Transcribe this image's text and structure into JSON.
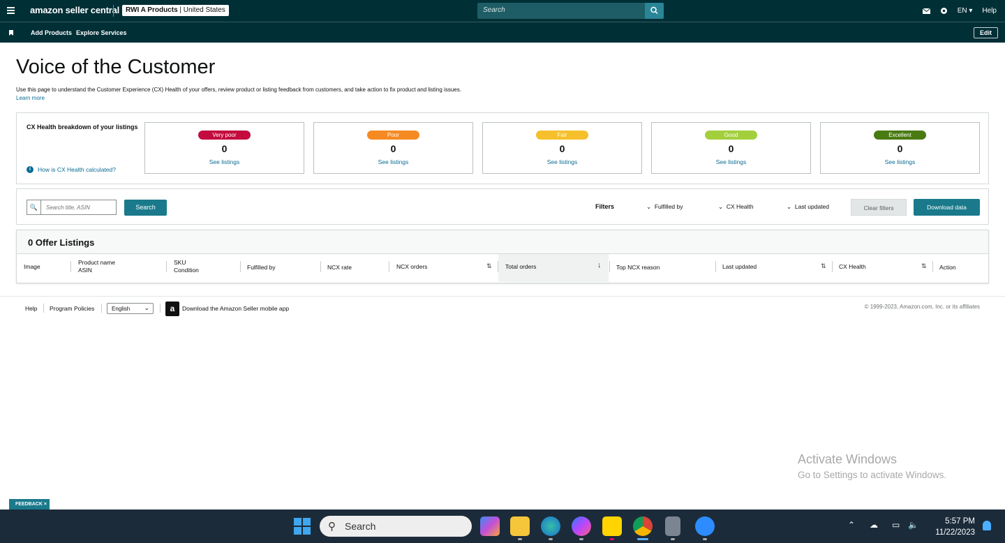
{
  "header": {
    "logo": "amazon seller central",
    "store_name": "RWI A Products",
    "store_region": "United States",
    "search_placeholder": "Search",
    "language": "EN",
    "help": "Help"
  },
  "nav": {
    "items": [
      "Add Products",
      "Explore Services"
    ],
    "edit": "Edit"
  },
  "page": {
    "title": "Voice of the Customer",
    "description": "Use this page to understand the Customer Experience (CX) Health of your offers, review product or listing feedback from customers, and take action to fix product and listing issues.",
    "learn_more": "Learn more"
  },
  "cx": {
    "title": "CX Health breakdown of your listings",
    "how_calculated": "How is CX Health calculated?",
    "cards": [
      {
        "label": "Very poor",
        "count": "0",
        "link": "See listings",
        "color": "#c40b3f"
      },
      {
        "label": "Poor",
        "count": "0",
        "link": "See listings",
        "color": "#f68a22"
      },
      {
        "label": "Fair",
        "count": "0",
        "link": "See listings",
        "color": "#f5c02b"
      },
      {
        "label": "Good",
        "count": "0",
        "link": "See listings",
        "color": "#a3cf3d"
      },
      {
        "label": "Excellent",
        "count": "0",
        "link": "See listings",
        "color": "#4a7a12"
      }
    ]
  },
  "filters": {
    "search_placeholder": "Search title, ASIN",
    "search_button": "Search",
    "label": "Filters",
    "fulfilled_by": "Fulfilled by",
    "cx_health": "CX Health",
    "last_updated": "Last updated",
    "clear": "Clear filters",
    "download": "Download data"
  },
  "table": {
    "title": "0 Offer Listings",
    "columns": {
      "image": "Image",
      "product_name": "Product name",
      "asin": "ASIN",
      "sku": "SKU",
      "condition": "Condition",
      "fulfilled_by": "Fulfilled by",
      "ncx_rate": "NCX rate",
      "ncx_orders": "NCX orders",
      "total_orders": "Total orders",
      "top_ncx_reason": "Top NCX reason",
      "last_updated": "Last updated",
      "cx_health": "CX Health",
      "action": "Action"
    }
  },
  "footer": {
    "help": "Help",
    "program_policies": "Program Policies",
    "language": "English",
    "app_text": "Download the Amazon Seller mobile app",
    "copyright": "© 1999-2023, Amazon.com, Inc. or its affiliates"
  },
  "overlay": {
    "activate_title": "Activate Windows",
    "activate_sub": "Go to Settings to activate Windows.",
    "feedback": "FEEDBACK ×"
  },
  "taskbar": {
    "search": "Search",
    "time": "5:57 PM",
    "date": "11/22/2023"
  }
}
